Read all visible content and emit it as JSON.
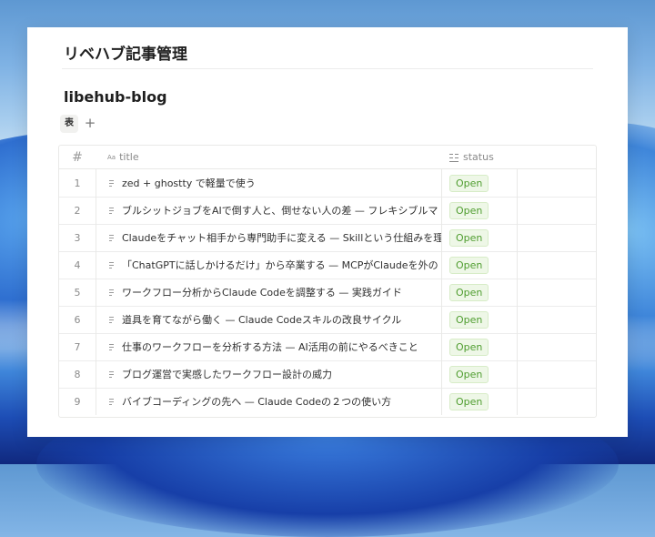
{
  "page": {
    "title": "リベハブ記事管理"
  },
  "database": {
    "title": "libehub-blog",
    "views": [
      {
        "label": "表"
      }
    ],
    "add_view_label": "+"
  },
  "table": {
    "headers": {
      "number": "#",
      "title_icon": "Aa",
      "title": "title",
      "status": "status"
    },
    "rows": [
      {
        "number": "1",
        "title": "zed + ghostty で軽量で使う",
        "status": "Open"
      },
      {
        "number": "2",
        "title": "ブルシットジョブをAIで倒す人と、倒せない人の差 — フレキシブルマ",
        "status": "Open"
      },
      {
        "number": "3",
        "title": "Claudeをチャット相手から専門助手に変える — Skillという仕組みを理",
        "status": "Open"
      },
      {
        "number": "4",
        "title": "「ChatGPTに話しかけるだけ」から卒業する — MCPがClaudeを外の",
        "status": "Open"
      },
      {
        "number": "5",
        "title": "ワークフロー分析からClaude Codeを調整する — 実践ガイド",
        "status": "Open"
      },
      {
        "number": "6",
        "title": "道具を育てながら働く — Claude Codeスキルの改良サイクル",
        "status": "Open"
      },
      {
        "number": "7",
        "title": "仕事のワークフローを分析する方法 — AI活用の前にやるべきこと",
        "status": "Open"
      },
      {
        "number": "8",
        "title": "ブログ運営で実感したワークフロー設計の威力",
        "status": "Open"
      },
      {
        "number": "9",
        "title": "バイブコーディングの先へ — Claude Codeの２つの使い方",
        "status": "Open"
      }
    ]
  },
  "colors": {
    "status_open_text": "#4f9d2f",
    "status_open_bg": "#eef7e7"
  }
}
